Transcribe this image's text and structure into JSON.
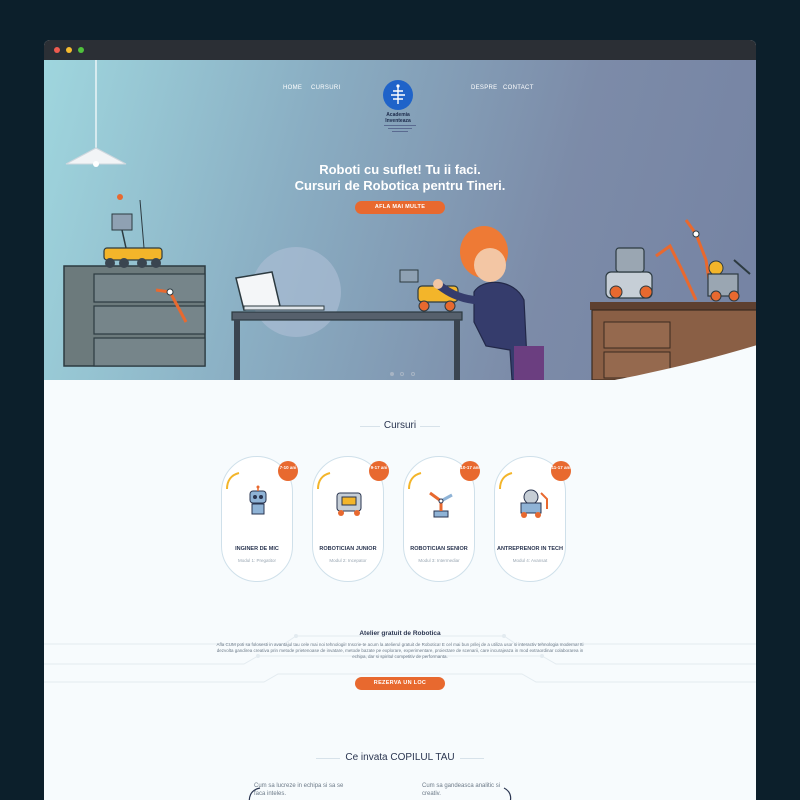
{
  "nav": {
    "home": "HOME",
    "cursuri": "CURSURI",
    "despre": "DESPRE",
    "contact": "CONTACT"
  },
  "logo": {
    "name_line1": "Academia",
    "name_line2": "Inventeaza"
  },
  "hero": {
    "title_line1": "Roboti cu suflet! Tu ii faci.",
    "title_line2": "Cursuri de Robotica pentru Tineri.",
    "cta": "AFLA MAI MULTE",
    "slides": 3,
    "active_slide": 1
  },
  "courses": {
    "title": "Cursuri",
    "items": [
      {
        "age": "7-10 ani",
        "name": "INGINER DE MIC",
        "module": "Modul 1: Pregatitor",
        "icon": "robot-icon"
      },
      {
        "age": "9-17 ani",
        "name": "ROBOTICIAN JUNIOR",
        "module": "Modul 2: Incepator",
        "icon": "robot-cart-icon"
      },
      {
        "age": "10-17 ani",
        "name": "ROBOTICIAN SENIOR",
        "module": "Modul 3: Intermediar",
        "icon": "robot-arm-icon"
      },
      {
        "age": "11-17 ani",
        "name": "ANTREPRENOR IN TECH",
        "module": "Modul 4: Avansat",
        "icon": "robot-lab-icon"
      }
    ]
  },
  "atelier": {
    "title": "Atelier gratuit de Robotica",
    "text": "Afla CUM poti sa folosesti in avantajul tau cele mai noi tehnologii! Inscrie-te acum la atelierul gratuit de Robotica! E cel mai bun prilej de a utiliza usor si interactiv tehnologia moderna! Iti dezvolta gandirea creativa prin metode prietenoase de invatare, metode bazate pe explorare, experimentare, proiectare de scenarii, care incurajeaza in mod extraordinar colaborarea in echipa, dar si spiritul competitiv de performanta.",
    "cta": "REZERVA UN LOC"
  },
  "learn": {
    "title": "Ce invata COPILUL TAU",
    "items": [
      "Cum sa lucreze in echipa si sa se faca inteles.",
      "Cum sa gandeasca analitic si creativ."
    ]
  },
  "colors": {
    "accent": "#e8692f",
    "navy": "#2a3550",
    "logo_blue": "#1f63c9"
  }
}
